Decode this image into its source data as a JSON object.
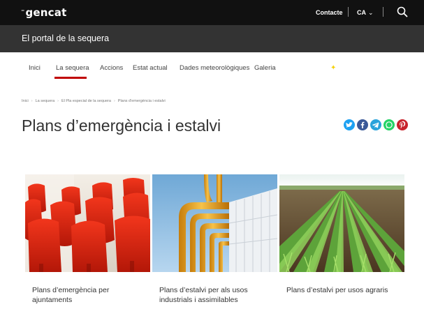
{
  "header": {
    "logo": "gencat",
    "logo_mark": "⁼",
    "contact_label": "Contacte",
    "language": "CA",
    "search_icon": "search-icon"
  },
  "site": {
    "title": "El portal de la sequera"
  },
  "nav": {
    "items": [
      "Inici",
      "La sequera",
      "Accions",
      "Estat actual",
      "Dades meteorològiques",
      "Galeria"
    ],
    "active": "La sequera"
  },
  "breadcrumb": [
    "Inici",
    "La sequera",
    "El Pla especial de la sequera",
    "Plans d'emergència i estalvi"
  ],
  "page": {
    "title": "Plans d’emergència i estalvi"
  },
  "share": {
    "icons": [
      "twitter-icon",
      "facebook-icon",
      "telegram-icon",
      "whatsapp-icon",
      "pinterest-icon"
    ],
    "colors": {
      "twitter": "#1da1f2",
      "facebook": "#3b5998",
      "telegram": "#2aa3db",
      "whatsapp": "#25d366",
      "pinterest": "#c8232c"
    }
  },
  "cards": [
    {
      "label": "Plans d’emergència per ajuntaments",
      "image": "red-auditorium-chairs"
    },
    {
      "label": "Plans d’estalvi per als usos industrials i assimilables",
      "image": "industrial-yellow-pipes"
    },
    {
      "label": "Plans d’estalvi per usos agraris",
      "image": "crop-field"
    }
  ],
  "colors": {
    "topbar": "#111111",
    "sitebar": "#333333",
    "accent": "#c00000"
  }
}
